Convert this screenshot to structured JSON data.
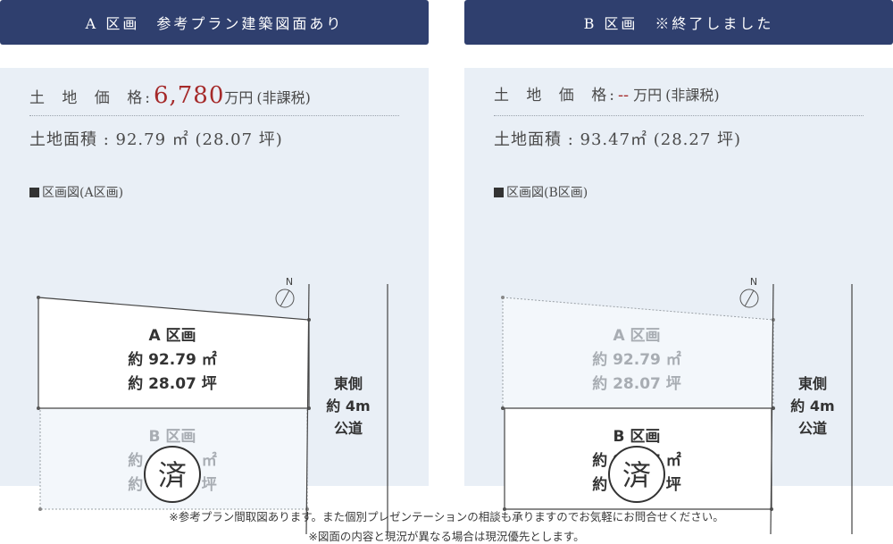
{
  "lot_a": {
    "header": "A 区画　参考プラン建築図面あり",
    "price_label": "土 地 価 格",
    "colon": ":",
    "price_value": "6,780",
    "price_unit": "万円",
    "tax_note": "(非課税)",
    "area_line": "土地面積 : 92.79 ㎡ (28.07 坪)",
    "plan_label": "区画図(A区画)",
    "plan": {
      "north": "N",
      "lot_a_name": "A 区画",
      "lot_a_sqm": "約 92.79 ㎡",
      "lot_a_tsubo": "約 28.07 坪",
      "lot_b_name": "B 区画",
      "lot_b_sqm": "約 92.79 ㎡",
      "lot_b_tsubo": "約 28.07 坪",
      "sold_stamp": "済",
      "road_1": "東側",
      "road_2": "約 4m",
      "road_3": "公道"
    }
  },
  "lot_b": {
    "header": "B 区画　※終了しました",
    "price_label": "土 地 価 格",
    "colon": ":",
    "price_value": "--",
    "price_unit": "万円",
    "tax_note": "(非課税)",
    "area_line": "土地面積 : 93.47㎡ (28.27 坪)",
    "plan_label": "区画図(B区画)",
    "plan": {
      "north": "N",
      "lot_a_name": "A 区画",
      "lot_a_sqm": "約 92.79 ㎡",
      "lot_a_tsubo": "約 28.07 坪",
      "lot_b_name": "B 区画",
      "lot_b_sqm": "約 93.47 ㎡",
      "lot_b_tsubo": "約 28.27 坪",
      "sold_stamp": "済",
      "road_1": "東側",
      "road_2": "約 4m",
      "road_3": "公道"
    }
  },
  "footer": {
    "line1": "※参考プラン間取図あります。また個別プレゼンテーションの相談も承りますのでお気軽にお問合せください。",
    "line2": "※図面の内容と現況が異なる場合は現況優先とします。"
  },
  "colors": {
    "header_bg": "#2f3f6e",
    "panel_bg": "#e9eff6",
    "price_accent": "#a52a2a"
  }
}
